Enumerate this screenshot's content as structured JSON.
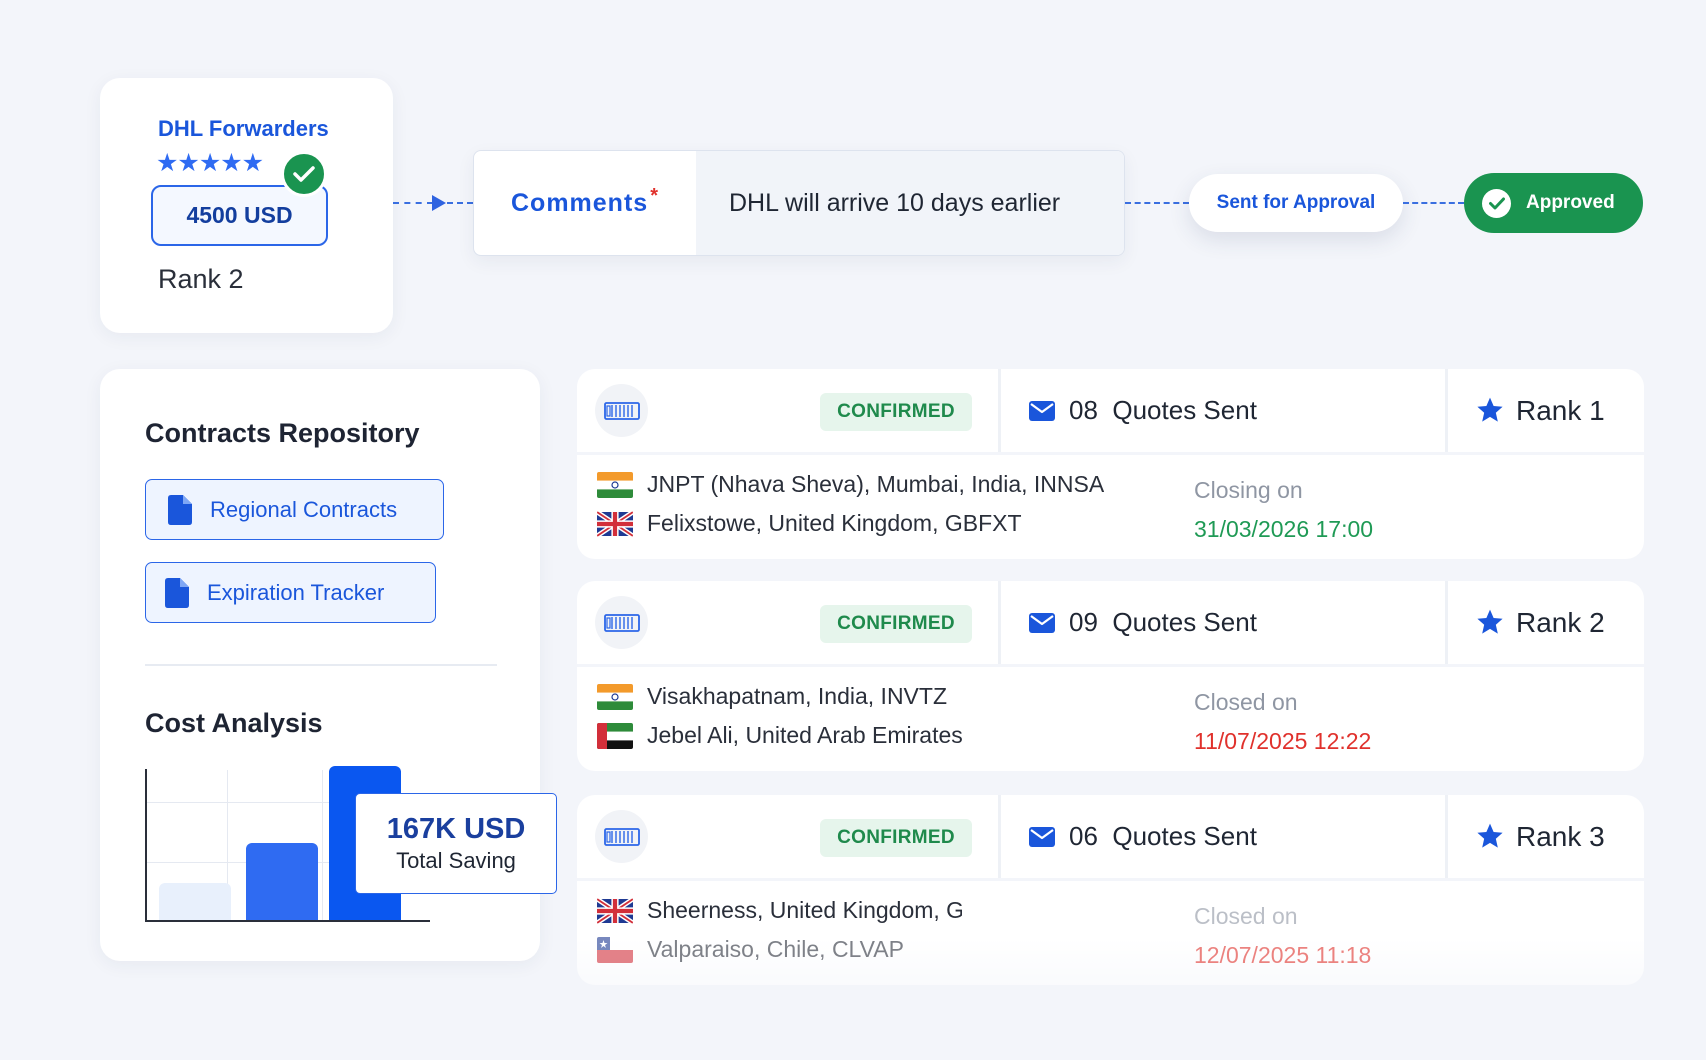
{
  "vendor_card": {
    "name": "DHL Forwarders",
    "stars": "★★★★★",
    "price": "4500 USD",
    "rank": "Rank 2"
  },
  "comments": {
    "label": "Comments",
    "required_mark": "*",
    "text": "DHL will arrive 10 days earlier"
  },
  "workflow": {
    "sent_label": "Sent for Approval",
    "approved_label": "Approved"
  },
  "repository": {
    "title": "Contracts Repository",
    "buttons": [
      {
        "label": "Regional Contracts"
      },
      {
        "label": "Expiration Tracker"
      }
    ],
    "cost_title": "Cost Analysis",
    "saving_amount": "167K USD",
    "saving_label": "Total Saving"
  },
  "chart_data": {
    "type": "bar",
    "title": "Cost Analysis",
    "categories": [
      "",
      "",
      ""
    ],
    "values": [
      0.24,
      0.5,
      1.0
    ],
    "colors": [
      "#e8f0fc",
      "#2f6bf2",
      "#0a57f0"
    ],
    "grid": true
  },
  "shipments": [
    {
      "status": "CONFIRMED",
      "quotes_count": "08",
      "quotes_label": "Quotes Sent",
      "rank": "Rank 1",
      "origin": "JNPT (Nhava Sheva), Mumbai, India, INNSA",
      "origin_flag": "india-flag",
      "destination": "Felixstowe, United Kingdom, GBFXT",
      "destination_flag": "uk-flag",
      "closing_label": "Closing on",
      "closing_date": "31/03/2026 17:00",
      "closing_color": "#1f9a55"
    },
    {
      "status": "CONFIRMED",
      "quotes_count": "09",
      "quotes_label": "Quotes Sent",
      "rank": "Rank 2",
      "origin": "Visakhapatnam, India, INVTZ",
      "origin_flag": "india-flag",
      "destination": "Jebel Ali, United Arab Emirates",
      "destination_flag": "uae-flag",
      "closing_label": "Closed on",
      "closing_date": "11/07/2025 12:22",
      "closing_color": "#e0312c"
    },
    {
      "status": "CONFIRMED",
      "quotes_count": "06",
      "quotes_label": "Quotes Sent",
      "rank": "Rank 3",
      "origin": "Sheerness, United Kingdom, G",
      "origin_flag": "uk-flag",
      "destination": "Valparaiso, Chile, CLVAP",
      "destination_flag": "chile-flag",
      "closing_label": "Closed on",
      "closing_date": "12/07/2025 11:18",
      "closing_color": "#e0312c"
    }
  ],
  "colors": {
    "accent_blue": "#1a56db",
    "success_green": "#1a9450",
    "background": "#f3f5fa"
  }
}
